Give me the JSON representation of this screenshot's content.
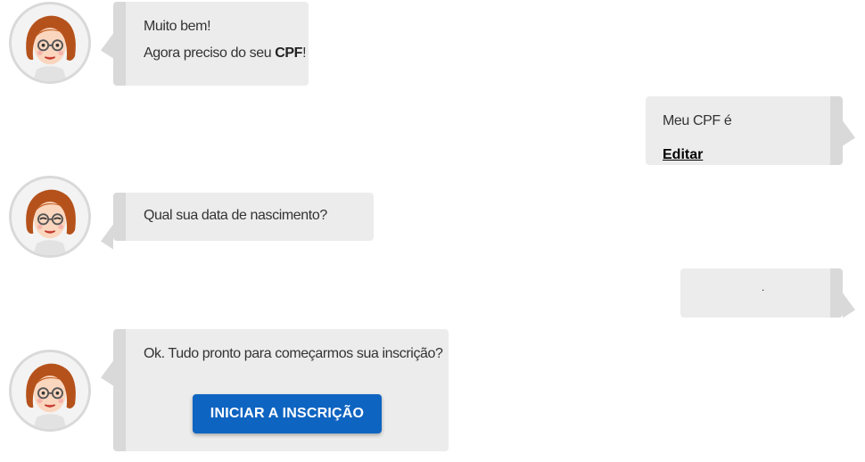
{
  "messages": [
    {
      "sender": "bot",
      "lines": [
        "Muito bem!"
      ],
      "line2_prefix": "Agora preciso do seu ",
      "line2_bold": "CPF",
      "line2_suffix": "!"
    },
    {
      "sender": "user",
      "text": "Meu CPF é",
      "link": "Editar"
    },
    {
      "sender": "bot",
      "text": "Qual sua data de nascimento?"
    },
    {
      "sender": "user",
      "text": "."
    },
    {
      "sender": "bot",
      "text": "Ok. Tudo pronto para começarmos sua inscrição?",
      "button": "INICIAR A INSCRIÇÃO"
    }
  ],
  "avatar": {
    "icon": "woman-with-glasses-avatar-icon"
  },
  "colors": {
    "bubble": "#ececec",
    "bubble_edge": "#d9d9d9",
    "button": "#0e64c1"
  }
}
